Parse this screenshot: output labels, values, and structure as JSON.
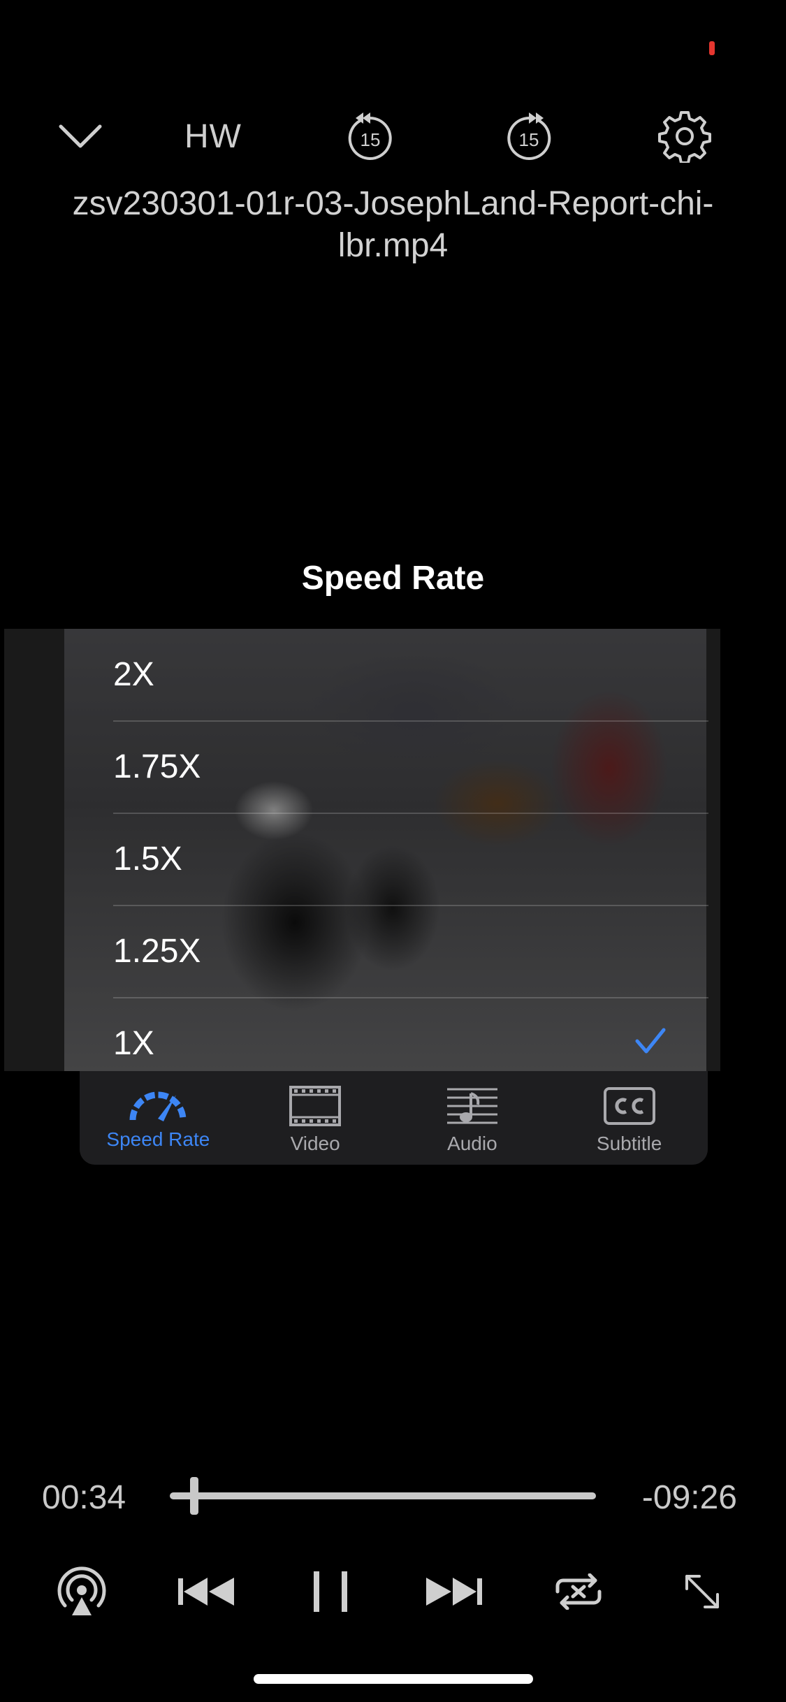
{
  "header": {
    "hw_label": "HW",
    "skip_back_seconds": "15",
    "skip_forward_seconds": "15",
    "file_name": "zsv230301-01r-03-JosephLand-Report-chi-lbr.mp4"
  },
  "speed_panel": {
    "title": "Speed Rate",
    "options": [
      "2X",
      "1.75X",
      "1.5X",
      "1.25X",
      "1X"
    ],
    "selected": "1X"
  },
  "tabs": [
    {
      "label": "Speed Rate",
      "icon": "speedometer-icon",
      "active": true
    },
    {
      "label": "Video",
      "icon": "film-icon",
      "active": false
    },
    {
      "label": "Audio",
      "icon": "music-note-icon",
      "active": false
    },
    {
      "label": "Subtitle",
      "icon": "cc-icon",
      "active": false
    }
  ],
  "playback": {
    "elapsed": "00:34",
    "remaining": "-09:26",
    "progress_fraction": 0.057
  },
  "colors": {
    "accent": "#3d86f5",
    "background": "#000000",
    "recording_indicator": "#e5362f"
  }
}
